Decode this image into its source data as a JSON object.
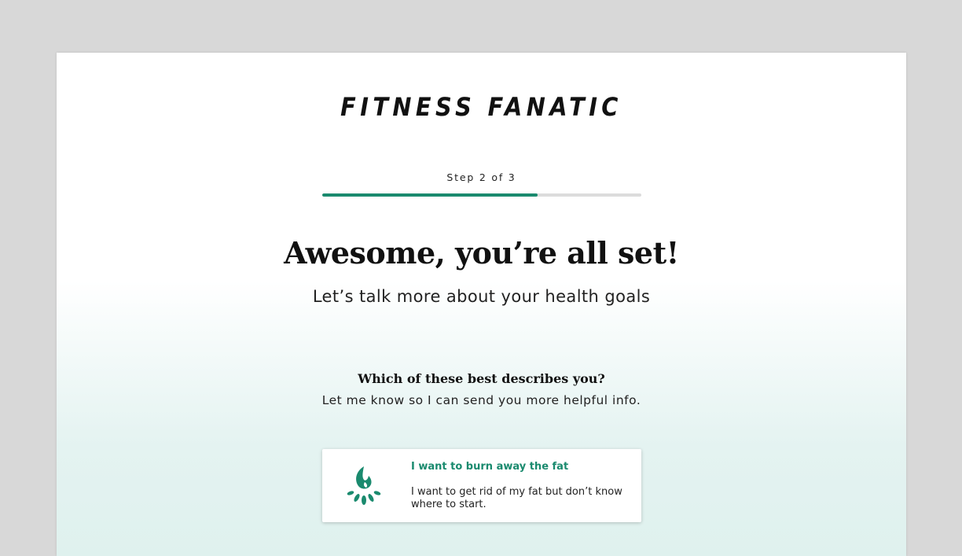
{
  "brand": {
    "logo_text": "FITNESS FANATIC"
  },
  "progress": {
    "label": "Step 2 of 3",
    "fraction": 0.674,
    "color": "#1a8a6e"
  },
  "hero": {
    "headline": "Awesome, you’re all set!",
    "subhead": "Let’s talk more about your health goals"
  },
  "question": {
    "title": "Which of these best describes you?",
    "subtitle": "Let me know so I can send you more helpful info."
  },
  "options": [
    {
      "icon": "campfire-icon",
      "title": "I want to burn away the fat",
      "description": "I want to get rid of my fat but don’t know where to start."
    }
  ]
}
